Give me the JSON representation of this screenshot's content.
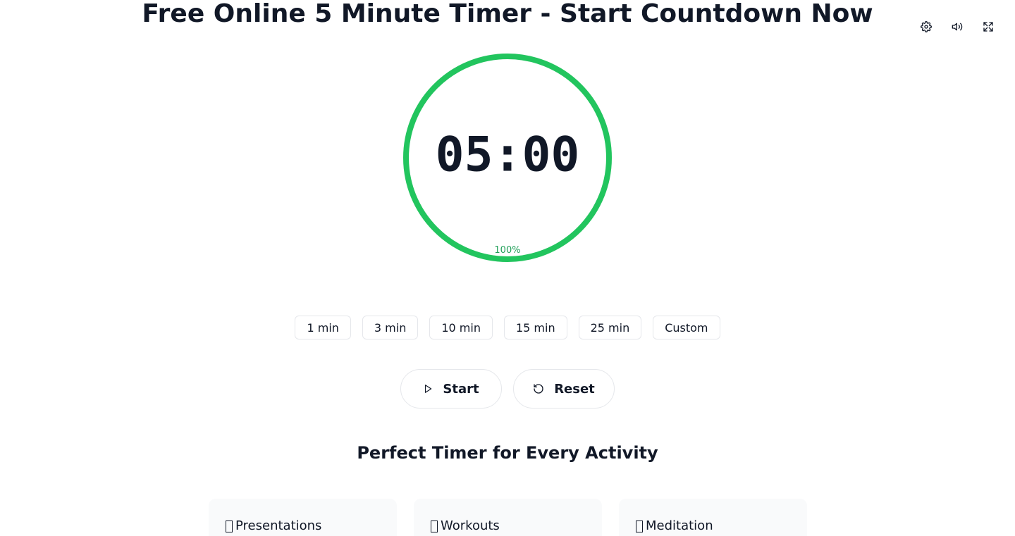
{
  "header": {
    "title": "Free Online 5 Minute Timer - Start Countdown Now",
    "icons": [
      "gear-icon",
      "volume-icon",
      "fullscreen-icon"
    ]
  },
  "timer": {
    "time": "05:00",
    "percent_label": "100%",
    "progress": 1.0,
    "ring_color": "#22c55e"
  },
  "presets": [
    "1 min",
    "3 min",
    "10 min",
    "15 min",
    "25 min",
    "Custom"
  ],
  "controls": {
    "start_label": "Start",
    "reset_label": "Reset"
  },
  "activities": {
    "title": "Perfect Timer for Every Activity",
    "cards": [
      "Presentations",
      "Workouts",
      "Meditation"
    ]
  }
}
